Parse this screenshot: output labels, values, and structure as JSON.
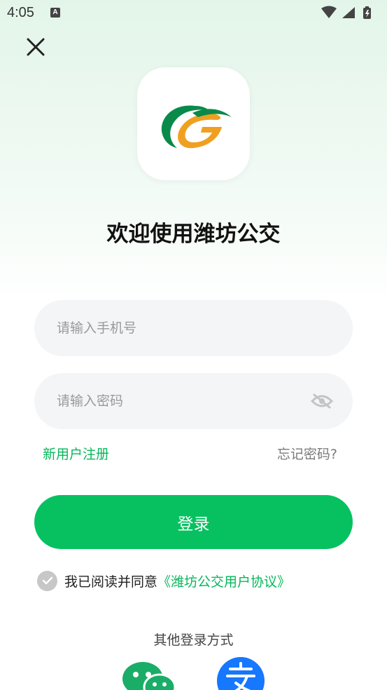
{
  "status_bar": {
    "time": "4:05",
    "notification_badge": "A"
  },
  "app": {
    "welcome_title": "欢迎使用潍坊公交",
    "logo_icon": "weifang-bus-logo"
  },
  "form": {
    "phone_placeholder": "请输入手机号",
    "phone_value": "",
    "password_placeholder": "请输入密码",
    "password_value": "",
    "register_label": "新用户注册",
    "forgot_label": "忘记密码?",
    "login_label": "登录"
  },
  "agreement": {
    "checked": true,
    "text": "我已阅读并同意",
    "link": "《潍坊公交用户协议》"
  },
  "other_login": {
    "title": "其他登录方式",
    "methods": [
      "wechat-icon",
      "alipay-icon"
    ]
  },
  "colors": {
    "brand_green": "#07c160",
    "link_green": "#07b75b",
    "logo_green": "#0a8a4a",
    "logo_orange": "#f0a020",
    "alipay_blue": "#1677ff",
    "wechat_green": "#1aad67"
  }
}
